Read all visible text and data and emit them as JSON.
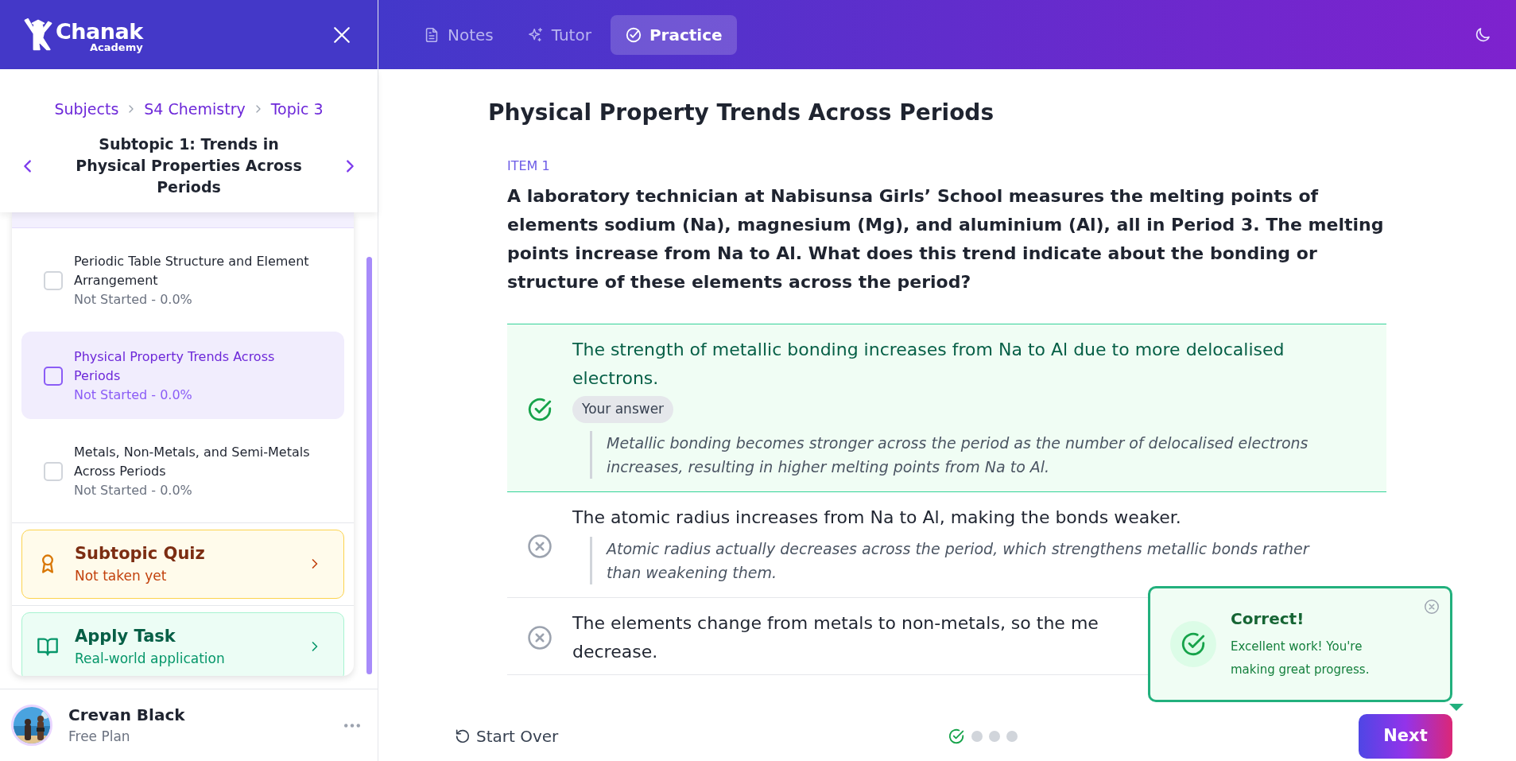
{
  "sidebar": {
    "logo": {
      "name": "Chanak",
      "tagline": "Academy"
    },
    "breadcrumb": [
      "Subjects",
      "S4 Chemistry",
      "Topic 3"
    ],
    "subtopic_title": "Subtopic 1: Trends in Physical Properties Across Periods",
    "lessons": [
      {
        "title": "Periodic Table Structure and Element Arrangement",
        "status": "Not Started - 0.0%",
        "selected": false,
        "checked": false
      },
      {
        "title": "Physical Property Trends Across Periods",
        "status": "Not Started - 0.0%",
        "selected": true,
        "checked": false
      },
      {
        "title": "Metals, Non-Metals, and Semi-Metals Across Periods",
        "status": "Not Started - 0.0%",
        "selected": false,
        "checked": false
      }
    ],
    "activities": [
      {
        "kind": "quiz",
        "title": "Subtopic Quiz",
        "subtitle": "Not taken yet"
      },
      {
        "kind": "task",
        "title": "Apply Task",
        "subtitle": "Real-world application"
      }
    ],
    "user": {
      "name": "Crevan Black",
      "plan": "Free Plan"
    }
  },
  "tabs": [
    {
      "kind": "notes",
      "label": "Notes",
      "selected": false
    },
    {
      "kind": "tutor",
      "label": "Tutor",
      "selected": false
    },
    {
      "kind": "practice",
      "label": "Practice",
      "selected": true
    }
  ],
  "main": {
    "title": "Physical Property Trends Across Periods",
    "item_label": "ITEM 1",
    "question": "A laboratory technician at Nabisunsa Girls’ School measures the melting points of elements sodium (Na), magnesium (Mg), and aluminium (Al), all in Period 3. The melting points increase from Na to Al. What does this trend indicate about the bonding or structure of these elements across the period?",
    "options": [
      {
        "kind": "correct",
        "selected": true,
        "text": "The strength of metallic bonding increases from Na to Al due to more delocalised electrons.",
        "badge": "Your answer",
        "explanation": "Metallic bonding becomes stronger across the period as the number of delocalised electrons increases, resulting in higher melting points from Na to Al."
      },
      {
        "kind": "wrong",
        "selected": false,
        "text": "The atomic radius increases from Na to Al, making the bonds weaker.",
        "explanation": "Atomic radius actually decreases across the period, which strengthens metallic bonds rather than weakening them."
      },
      {
        "kind": "wrong",
        "selected": false,
        "text": "The elements change from metals to non-metals, so the me\ndecrease."
      }
    ]
  },
  "footer": {
    "start_over": "Start Over",
    "progress": [
      {
        "kind": "correct"
      },
      {
        "kind": "pending"
      },
      {
        "kind": "pending"
      },
      {
        "kind": "pending"
      }
    ],
    "next": "Next"
  },
  "toast": {
    "title": "Correct!",
    "message": "Excellent work! You're making great progress."
  }
}
